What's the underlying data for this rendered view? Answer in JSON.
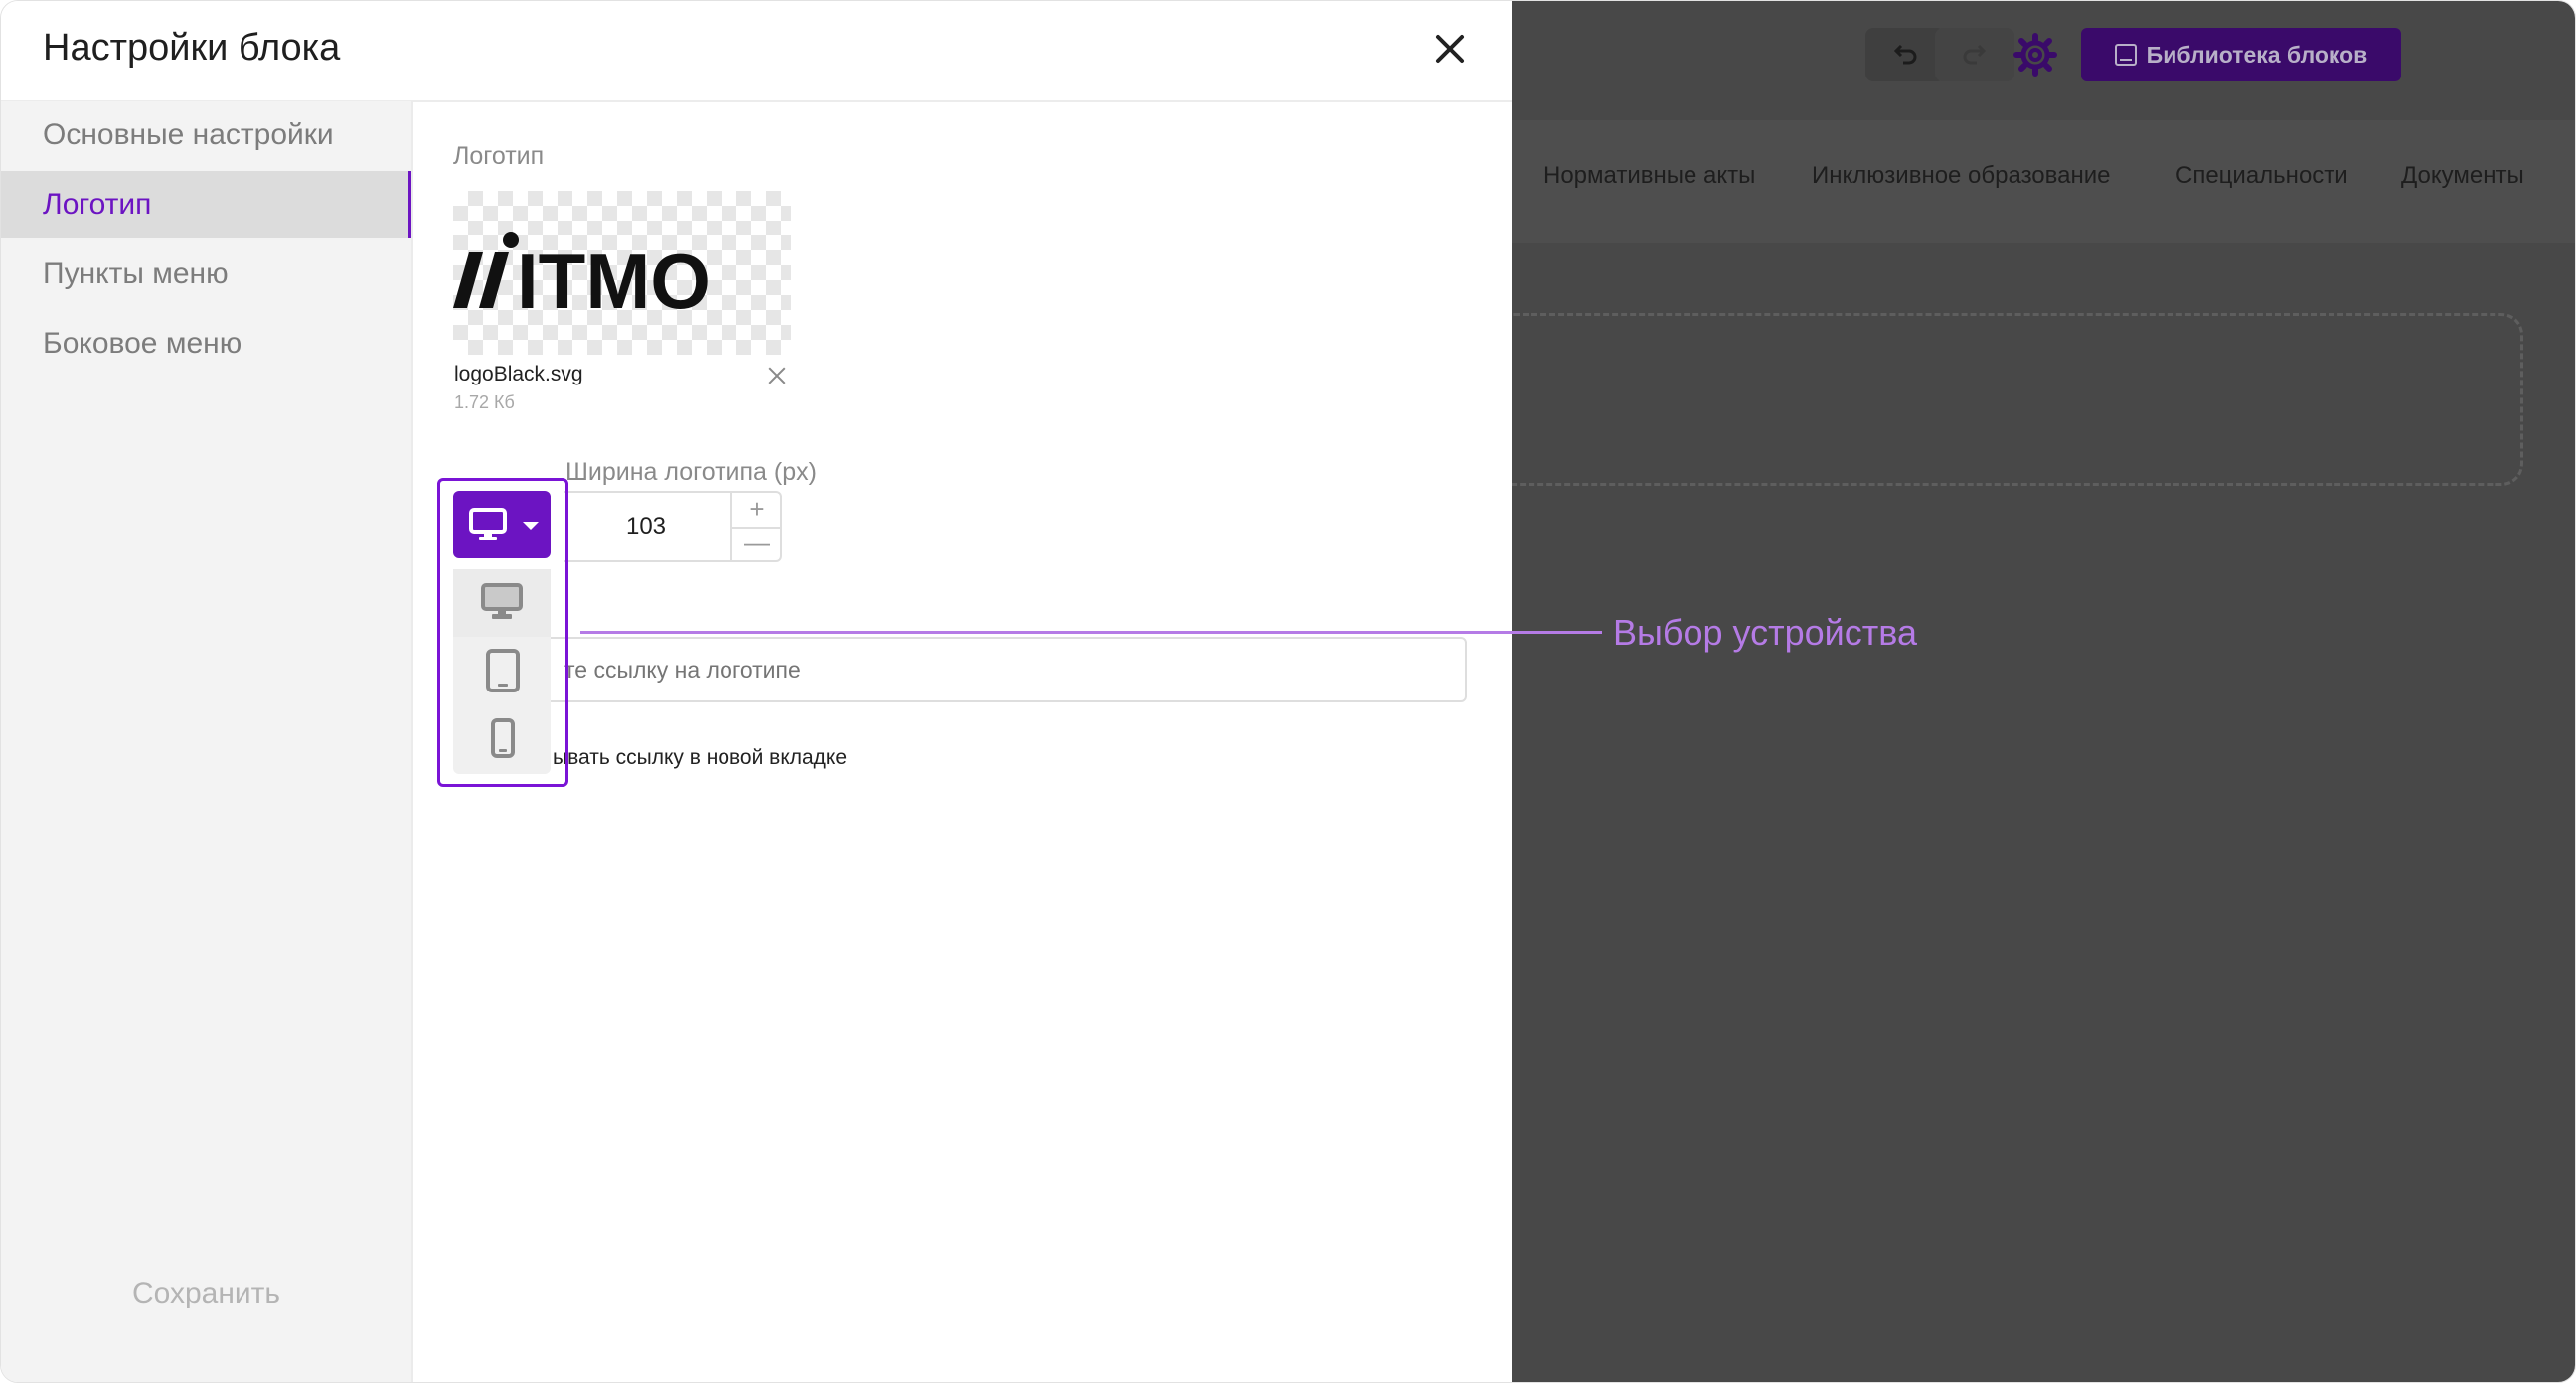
{
  "modal": {
    "title": "Настройки блока",
    "sidebar": {
      "items": [
        {
          "label": "Основные настройки",
          "active": false
        },
        {
          "label": "Логотип",
          "active": true
        },
        {
          "label": "Пункты меню",
          "active": false
        },
        {
          "label": "Боковое меню",
          "active": false
        }
      ],
      "save_label": "Сохранить"
    },
    "logo_section": {
      "label": "Логотип",
      "logo_text": "ITMO",
      "file_name": "logoBlack.svg",
      "file_size": "1.72 Кб"
    },
    "width_section": {
      "label": "Ширина логотипа (px)",
      "value": "103",
      "plus": "+",
      "minus": "—"
    },
    "link_section": {
      "placeholder": "те ссылку на логотипе",
      "new_tab_label": "ывать ссылку в новой вкладке"
    },
    "device_menu": {
      "selected": "desktop",
      "options": [
        "desktop",
        "tablet",
        "mobile"
      ],
      "icons": [
        "monitor-icon",
        "tablet-icon",
        "phone-icon"
      ]
    }
  },
  "background_editor": {
    "library_button": "Библиотека блоков",
    "nav_links": [
      "Нормативные акты",
      "Инклюзивное образование",
      "Специальности",
      "Документы"
    ]
  },
  "annotation": {
    "callout_text": "Выбор устройства",
    "color": "#b57be6"
  },
  "colors": {
    "accent": "#6c14c2",
    "overlay": "#484848",
    "highlight": "#7a14d6"
  }
}
